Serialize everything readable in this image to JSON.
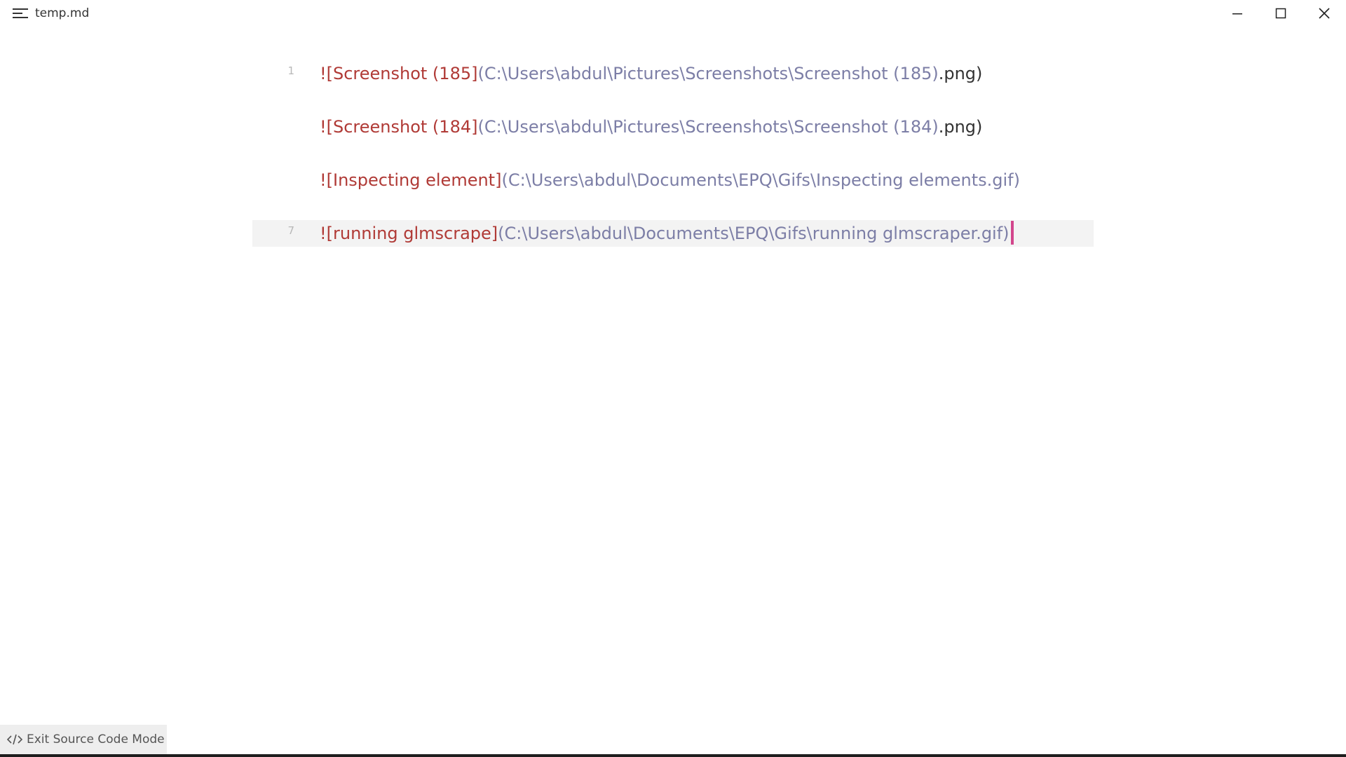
{
  "window": {
    "title": "temp.md",
    "menu_icon": "hamburger-menu-icon",
    "controls": [
      "minimize-icon",
      "maximize-icon",
      "close-icon"
    ]
  },
  "editor": {
    "lines": [
      {
        "number": "1",
        "alt": "![Screenshot (185]",
        "url": "(C:\\Users\\abdul\\Pictures\\Screenshots\\Screenshot (185)",
        "tail": ".png)"
      },
      {
        "number": "",
        "alt": "![Screenshot (184]",
        "url": "(C:\\Users\\abdul\\Pictures\\Screenshots\\Screenshot (184)",
        "tail": ".png)"
      },
      {
        "number": "",
        "alt": "![Inspecting element]",
        "url": "(C:\\Users\\abdul\\Documents\\EPQ\\Gifs\\Inspecting elements.gif)",
        "tail": ""
      },
      {
        "number": "7",
        "alt": "![running glmscrape]",
        "url": "(C:\\Users\\abdul\\Documents\\EPQ\\Gifs\\running glmscraper.gif)",
        "tail": ""
      }
    ]
  },
  "statusbar": {
    "icon": "code-icon",
    "label": "Exit Source Code Mode"
  },
  "colors": {
    "alt_text": "#b03a36",
    "url_text": "#7c7ea6",
    "cursor": "#d2468c",
    "active_line": "#f3f3f3"
  }
}
